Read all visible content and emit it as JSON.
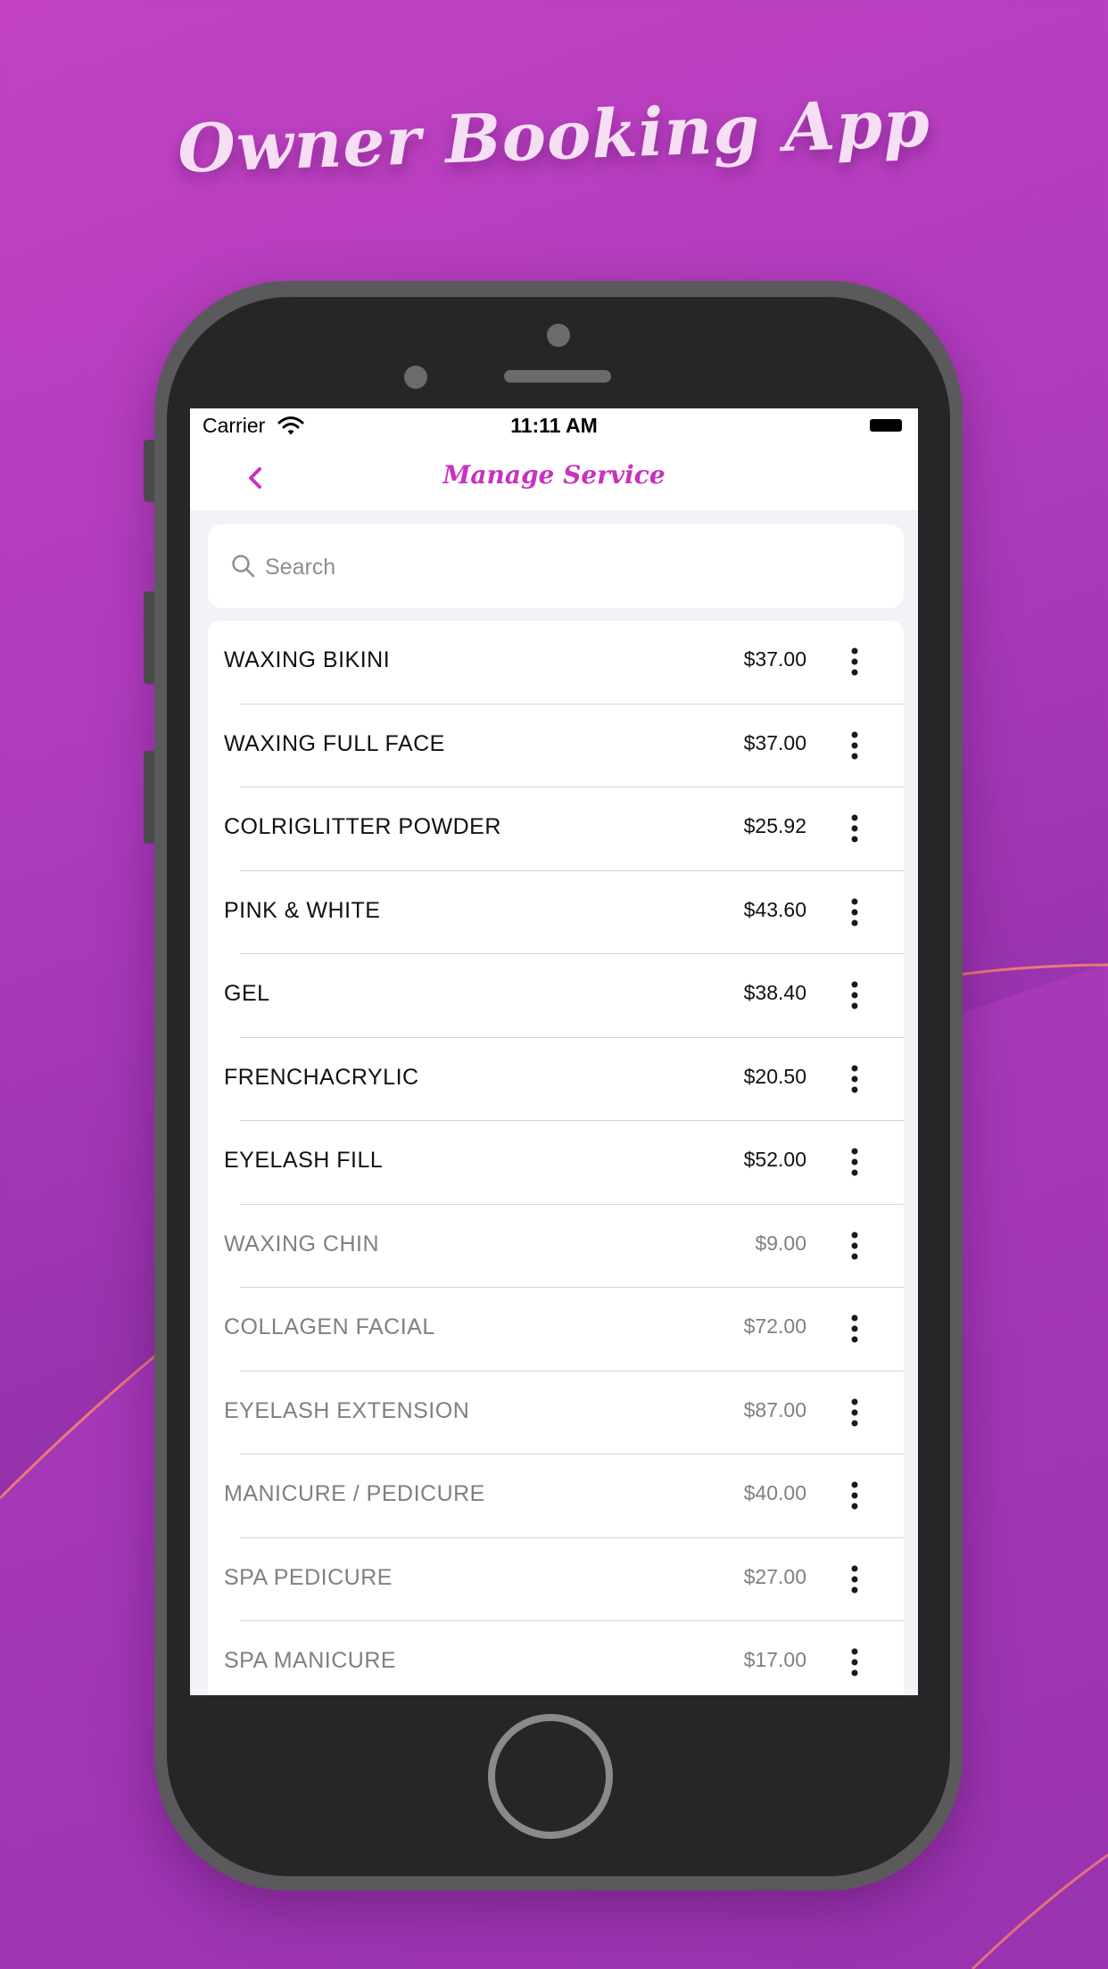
{
  "headline": "Owner Booking App",
  "status_bar": {
    "carrier": "Carrier",
    "time": "11:11 AM"
  },
  "nav": {
    "title": "Manage Service",
    "back_icon": "chevron-left-icon"
  },
  "search": {
    "placeholder": "Search",
    "value": "",
    "icon": "search-icon"
  },
  "colors": {
    "accent": "#c832bf",
    "active_text": "#111111",
    "inactive_text": "#7f7f85"
  },
  "services": [
    {
      "name": "WAXING BIKINI",
      "price": "$37.00",
      "active": true
    },
    {
      "name": "WAXING FULL FACE",
      "price": "$37.00",
      "active": true
    },
    {
      "name": "COLRIGLITTER POWDER",
      "price": "$25.92",
      "active": true
    },
    {
      "name": "PINK & WHITE",
      "price": "$43.60",
      "active": true
    },
    {
      "name": "GEL",
      "price": "$38.40",
      "active": true
    },
    {
      "name": "FRENCHACRYLIC",
      "price": "$20.50",
      "active": true
    },
    {
      "name": "EYELASH FILL",
      "price": "$52.00",
      "active": true
    },
    {
      "name": "WAXING CHIN",
      "price": "$9.00",
      "active": false
    },
    {
      "name": "COLLAGEN FACIAL",
      "price": "$72.00",
      "active": false
    },
    {
      "name": "EYELASH EXTENSION",
      "price": "$87.00",
      "active": false
    },
    {
      "name": "MANICURE / PEDICURE",
      "price": "$40.00",
      "active": false
    },
    {
      "name": "SPA PEDICURE",
      "price": "$27.00",
      "active": false
    },
    {
      "name": "SPA MANICURE",
      "price": "$17.00",
      "active": false
    }
  ]
}
